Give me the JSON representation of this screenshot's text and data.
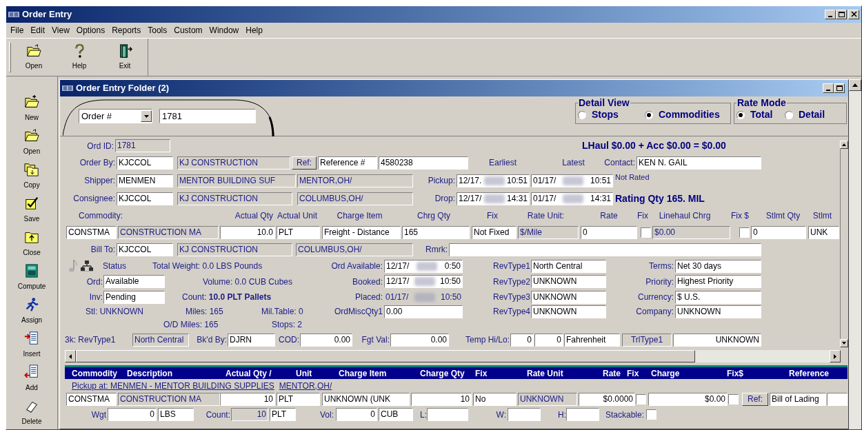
{
  "window": {
    "title": "Order Entry"
  },
  "menu": [
    "File",
    "Edit",
    "View",
    "Options",
    "Reports",
    "Tools",
    "Custom",
    "Window",
    "Help"
  ],
  "toolbar": [
    "Open",
    "Help",
    "Exit"
  ],
  "sidebar": [
    "New",
    "Open",
    "Copy",
    "Save",
    "Close",
    "Compute",
    "Assign",
    "Insert",
    "Add",
    "Delete"
  ],
  "folder": {
    "title": "Order Entry Folder (2)",
    "lookup": {
      "field": "Order #",
      "value": "1781"
    },
    "detail_view": {
      "label": "Detail View",
      "options": [
        {
          "label": "Stops",
          "selected": false
        },
        {
          "label": "Commodities",
          "selected": true
        }
      ]
    },
    "rate_mode": {
      "label": "Rate Mode",
      "options": [
        {
          "label": "Total",
          "selected": true
        },
        {
          "label": "Detail",
          "selected": false
        }
      ]
    },
    "form": {
      "rows": [
        {
          "items": [
            {
              "kind": "label",
              "text": "Ord ID:"
            },
            {
              "kind": "readonly",
              "text": "1781"
            },
            {
              "kind": "bold",
              "text": "LHaul $0.00 + Acc $0.00 = $0.00"
            }
          ]
        },
        {
          "items": [
            {
              "kind": "label",
              "text": "Order By:"
            },
            {
              "kind": "field",
              "text": "KJCCOL"
            },
            {
              "kind": "readonly",
              "text": "KJ CONSTRUCTION"
            },
            {
              "kind": "button",
              "text": "Ref:"
            },
            {
              "kind": "field",
              "text": "Reference #"
            },
            {
              "kind": "field",
              "text": "4580238"
            },
            {
              "kind": "label",
              "text": "Earliest"
            },
            {
              "kind": "label",
              "text": "Latest"
            },
            {
              "kind": "label",
              "text": "Contact:"
            },
            {
              "kind": "field",
              "text": "KEN N. GAIL"
            }
          ]
        },
        {
          "items": [
            {
              "kind": "label",
              "text": "Shipper:"
            },
            {
              "kind": "field",
              "text": "MENMEN"
            },
            {
              "kind": "readonly",
              "text": "MENTOR BUILDING SUF"
            },
            {
              "kind": "readonly",
              "text": "MENTOR,OH/"
            },
            {
              "kind": "label",
              "text": "Pickup:"
            },
            {
              "kind": "datetime",
              "date": "12/17.",
              "time": "10:51"
            },
            {
              "kind": "datetime",
              "date": "01/17/",
              "time": "10:51"
            },
            {
              "kind": "note",
              "text": "Not Rated"
            }
          ]
        },
        {
          "items": [
            {
              "kind": "label",
              "text": "Consignee:"
            },
            {
              "kind": "field",
              "text": "KJCCOL"
            },
            {
              "kind": "readonly",
              "text": "KJ CONSTRUCTION"
            },
            {
              "kind": "readonly",
              "text": "COLUMBUS,OH/"
            },
            {
              "kind": "label",
              "text": "Drop:"
            },
            {
              "kind": "datetime",
              "date": "12/17/",
              "time": "14:31"
            },
            {
              "kind": "datetime",
              "date": "01/17/",
              "time": "14:31"
            },
            {
              "kind": "bold",
              "text": "Rating Qty  165. MIL"
            }
          ]
        },
        {
          "items": [
            {
              "kind": "heading",
              "text": "Commodity:"
            },
            {
              "kind": "heading",
              "text": "Actual Qty"
            },
            {
              "kind": "heading",
              "text": "Actual Unit"
            },
            {
              "kind": "heading",
              "text": "Charge Item"
            },
            {
              "kind": "heading",
              "text": "Chrg Qty"
            },
            {
              "kind": "heading",
              "text": "Fix"
            },
            {
              "kind": "heading",
              "text": "Rate Unit:"
            },
            {
              "kind": "heading",
              "text": "Rate"
            },
            {
              "kind": "heading",
              "text": "Fix"
            },
            {
              "kind": "heading",
              "text": "Linehaul Chrg"
            },
            {
              "kind": "heading",
              "text": "Fix $"
            },
            {
              "kind": "heading",
              "text": "Stlmt Qty"
            },
            {
              "kind": "heading",
              "text": "Stlmt"
            }
          ]
        },
        {
          "items": [
            {
              "kind": "field",
              "text": "CONSTMA"
            },
            {
              "kind": "readonly",
              "text": "CONSTRUCTION MA"
            },
            {
              "kind": "field",
              "text": "10.0"
            },
            {
              "kind": "field",
              "text": "PLT"
            },
            {
              "kind": "field",
              "text": "Freight - Distance"
            },
            {
              "kind": "field",
              "text": "165"
            },
            {
              "kind": "field",
              "text": "Not Fixed"
            },
            {
              "kind": "readonly",
              "text": "$/Mile"
            },
            {
              "kind": "field",
              "text": "0"
            },
            {
              "kind": "check",
              "checked": false
            },
            {
              "kind": "readonly",
              "text": "$0.00"
            },
            {
              "kind": "check",
              "checked": false
            },
            {
              "kind": "field",
              "text": "0"
            },
            {
              "kind": "field",
              "text": "UNK"
            }
          ]
        },
        {
          "items": [
            {
              "kind": "label",
              "text": "Bill To:"
            },
            {
              "kind": "field",
              "text": "KJCCOL"
            },
            {
              "kind": "readonly",
              "text": "KJ CONSTRUCTION"
            },
            {
              "kind": "readonly",
              "text": "COLUMBUS,OH/"
            },
            {
              "kind": "label",
              "text": "Rmrk:"
            },
            {
              "kind": "field"
            }
          ]
        },
        {
          "items": [
            {
              "kind": "status",
              "text": "Status"
            },
            {
              "kind": "text",
              "text": "Total Weight: 0.0 LBS Pounds"
            },
            {
              "kind": "label",
              "text": "Ord Available:"
            },
            {
              "kind": "datetime",
              "date": "12/17/",
              "time": "0:50"
            },
            {
              "kind": "label",
              "text": "RevType1"
            },
            {
              "kind": "field",
              "text": "North Central"
            },
            {
              "kind": "label",
              "text": "Terms:"
            },
            {
              "kind": "field",
              "text": "Net 30 days"
            }
          ]
        },
        {
          "items": [
            {
              "kind": "label",
              "text": "Ord:"
            },
            {
              "kind": "field",
              "text": "Available"
            },
            {
              "kind": "text",
              "text": "Volume: 0.0 CUB Cubes"
            },
            {
              "kind": "label",
              "text": "Booked:"
            },
            {
              "kind": "datetime",
              "date": "12/17/",
              "time": "10:50"
            },
            {
              "kind": "label",
              "text": "RevType2"
            },
            {
              "kind": "field",
              "text": "UNKNOWN"
            },
            {
              "kind": "label",
              "text": "Priority:"
            },
            {
              "kind": "field",
              "text": "Highest Priority"
            }
          ]
        },
        {
          "items": [
            {
              "kind": "label",
              "text": "Inv:"
            },
            {
              "kind": "field",
              "text": "Pending"
            },
            {
              "kind": "text",
              "text": "Count: **10.0 PLT Pallets**"
            },
            {
              "kind": "label",
              "text": "Placed:"
            },
            {
              "kind": "datetime_static",
              "date": "01/17/",
              "time": "10:50"
            },
            {
              "kind": "label",
              "text": "RevType3"
            },
            {
              "kind": "field",
              "text": "UNKNOWN"
            },
            {
              "kind": "label",
              "text": "Currency:"
            },
            {
              "kind": "field",
              "text": "$ U.S."
            }
          ]
        },
        {
          "items": [
            {
              "kind": "text",
              "text": "Stl: UNKNOWN"
            },
            {
              "kind": "text",
              "text": "Miles: 165"
            },
            {
              "kind": "text",
              "text": "Mil.Table: 0"
            },
            {
              "kind": "label",
              "text": "OrdMiscQty1"
            },
            {
              "kind": "field",
              "text": "0.00"
            },
            {
              "kind": "label",
              "text": "RevType4"
            },
            {
              "kind": "field",
              "text": "UNKNOWN"
            },
            {
              "kind": "label",
              "text": "Company:"
            },
            {
              "kind": "field",
              "text": "UNKNOWN"
            }
          ]
        },
        {
          "items": [
            {
              "kind": "text",
              "text": "O/D Miles: 165"
            },
            {
              "kind": "text",
              "text": "Stops: 2"
            }
          ]
        },
        {
          "items": [
            {
              "kind": "label",
              "text": "3k: RevType1"
            },
            {
              "kind": "readonly",
              "text": "North Central"
            },
            {
              "kind": "label",
              "text": "Bk'd By:"
            },
            {
              "kind": "field",
              "text": "DJRN"
            },
            {
              "kind": "label",
              "text": "COD:"
            },
            {
              "kind": "field",
              "text": "0.00"
            },
            {
              "kind": "label",
              "text": "Fgt Val:"
            },
            {
              "kind": "field",
              "text": "0.00"
            },
            {
              "kind": "label",
              "text": "Temp Hi/Lo:"
            },
            {
              "kind": "field",
              "text": "0"
            },
            {
              "kind": "field",
              "text": "0"
            },
            {
              "kind": "field",
              "text": "Fahrenheit"
            },
            {
              "kind": "readonly",
              "text": "TrlType1"
            },
            {
              "kind": "field",
              "text": "UNKNOWN"
            }
          ]
        }
      ]
    },
    "grid": {
      "columns": [
        "Commodity",
        "Description",
        "Actual Qty /",
        "Unit",
        "Charge Item",
        "Charge Qty",
        "Fix",
        "Rate Unit",
        "Rate",
        "Fix",
        "Charge",
        "Fix$",
        "Reference"
      ],
      "pickup": [
        "Pickup at: MENMEN - MENTOR BUILDING SUPPLIES",
        "MENTOR,OH/"
      ],
      "rows": [
        {
          "items": [
            {
              "kind": "field",
              "text": "CONSTMA"
            },
            {
              "kind": "readonly",
              "text": "CONSTRUCTION MA"
            },
            {
              "kind": "field",
              "text": "10"
            },
            {
              "kind": "field",
              "text": "PLT"
            },
            {
              "kind": "field",
              "text": "UNKNOWN (UNK"
            },
            {
              "kind": "field",
              "text": "10"
            },
            {
              "kind": "field",
              "text": "No"
            },
            {
              "kind": "readonly",
              "text": "UNKNOWN"
            },
            {
              "kind": "field",
              "text": "$0.0000"
            },
            {
              "kind": "check",
              "checked": false
            },
            {
              "kind": "field",
              "text": "$0.00"
            },
            {
              "kind": "check",
              "checked": false
            },
            {
              "kind": "button",
              "text": "Ref:"
            },
            {
              "kind": "field",
              "text": "Bill of Lading"
            },
            {
              "kind": "field"
            }
          ]
        },
        {
          "items": [
            {
              "kind": "label",
              "text": "Wgt"
            },
            {
              "kind": "field",
              "text": "0"
            },
            {
              "kind": "field",
              "text": "LBS"
            },
            {
              "kind": "label",
              "text": "Count:"
            },
            {
              "kind": "readonly",
              "text": "10"
            },
            {
              "kind": "field",
              "text": "PLT"
            },
            {
              "kind": "label",
              "text": "Vol:"
            },
            {
              "kind": "field",
              "text": "0"
            },
            {
              "kind": "field",
              "text": "CUB"
            },
            {
              "kind": "label",
              "text": "L:"
            },
            {
              "kind": "field"
            },
            {
              "kind": "label",
              "text": "W:"
            },
            {
              "kind": "field"
            },
            {
              "kind": "label",
              "text": "H:"
            },
            {
              "kind": "field"
            },
            {
              "kind": "label",
              "text": "Stackable:"
            },
            {
              "kind": "check",
              "checked": false
            }
          ]
        }
      ]
    }
  }
}
